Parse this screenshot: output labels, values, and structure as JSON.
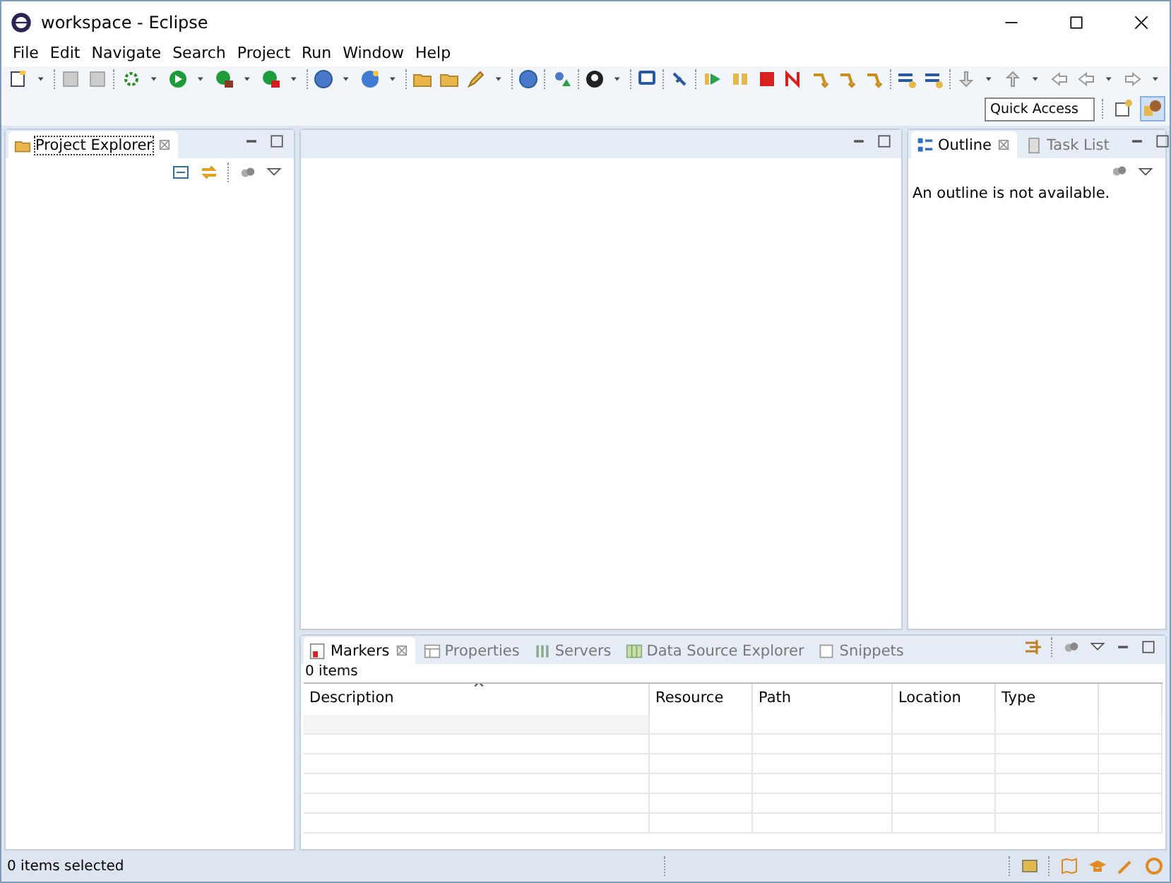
{
  "window": {
    "title": "workspace - Eclipse"
  },
  "menu": [
    {
      "label": "File"
    },
    {
      "label": "Edit"
    },
    {
      "label": "Navigate"
    },
    {
      "label": "Search"
    },
    {
      "label": "Project"
    },
    {
      "label": "Run"
    },
    {
      "label": "Window"
    },
    {
      "label": "Help"
    }
  ],
  "quick_access": {
    "placeholder": "Quick Access"
  },
  "left_panel": {
    "tabs": [
      {
        "label": "Project Explorer",
        "selected": true
      }
    ]
  },
  "right_panel": {
    "tabs": [
      {
        "label": "Outline",
        "selected": true
      },
      {
        "label": "Task List",
        "selected": false
      }
    ],
    "message": "An outline is not available."
  },
  "bottom_panel": {
    "tabs": [
      {
        "label": "Markers",
        "selected": true
      },
      {
        "label": "Properties",
        "selected": false
      },
      {
        "label": "Servers",
        "selected": false
      },
      {
        "label": "Data Source Explorer",
        "selected": false
      },
      {
        "label": "Snippets",
        "selected": false
      }
    ],
    "count": "0 items",
    "table": {
      "columns": [
        "Description",
        "Resource",
        "Path",
        "Location",
        "Type"
      ]
    }
  },
  "status_bar": {
    "text": "0 items selected"
  }
}
